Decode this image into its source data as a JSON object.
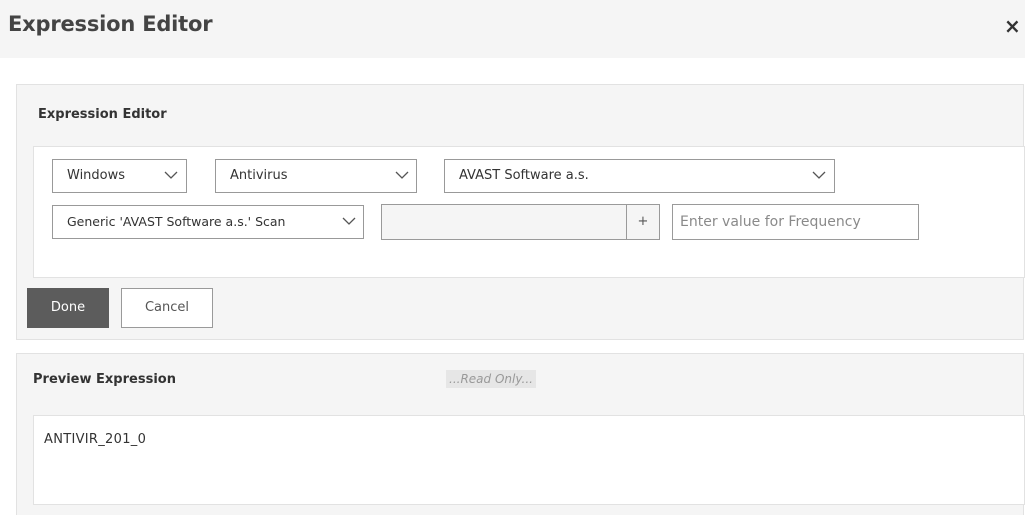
{
  "header": {
    "title": "Expression Editor",
    "close_glyph": "×"
  },
  "editor": {
    "label": "Expression Editor",
    "platform_select": {
      "value": "Windows"
    },
    "category_select": {
      "value": "Antivirus"
    },
    "vendor_select": {
      "value": "AVAST Software a.s."
    },
    "check_select": {
      "value": "Generic 'AVAST Software a.s.' Scan"
    },
    "value_input": {
      "value": ""
    },
    "add_button": {
      "label": "+"
    },
    "frequency_input": {
      "placeholder": "Enter value for Frequency",
      "value": ""
    },
    "done_label": "Done",
    "cancel_label": "Cancel"
  },
  "preview": {
    "label": "Preview Expression",
    "readonly_label": "...Read Only...",
    "expression": "ANTIVIR_201_0"
  },
  "icons": {
    "close": "close-icon",
    "dropdown": "chevron-down-icon",
    "add": "plus-icon"
  },
  "colors": {
    "header_bg": "#f5f5f5",
    "panel_bg": "#f5f5f5",
    "done_button_bg": "#5c5c5c",
    "border": "#999999"
  }
}
